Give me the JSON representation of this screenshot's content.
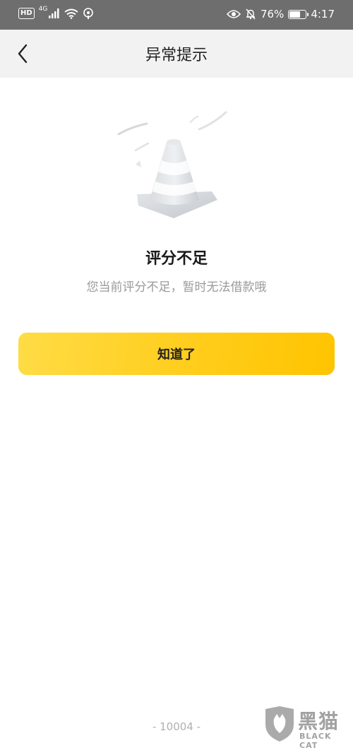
{
  "status_bar": {
    "hd": "HD",
    "network": "4G",
    "battery_percent": "76%",
    "battery_level": 0.76,
    "time": "4:17"
  },
  "nav": {
    "title": "异常提示",
    "back_icon": "chevron-left-icon"
  },
  "content": {
    "illustration_icon": "traffic-cone-icon",
    "title": "评分不足",
    "description": "您当前评分不足，暂时无法借款哦",
    "button_label": "知道了",
    "button_color": "#ffcd1c"
  },
  "footer": {
    "error_code": "- 10004 -"
  },
  "watermark": {
    "cn": "黑猫",
    "en": "BLACK CAT"
  }
}
